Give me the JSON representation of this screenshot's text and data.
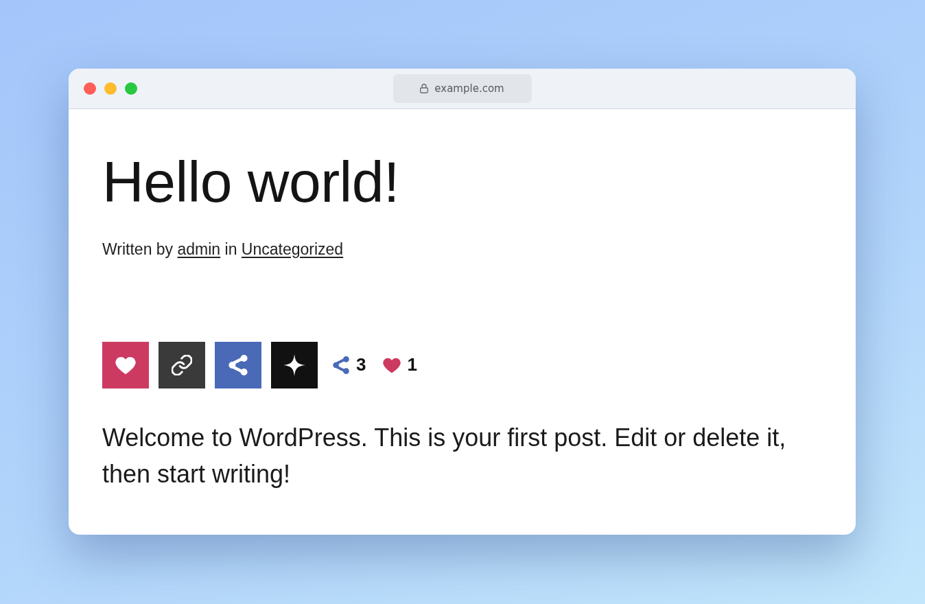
{
  "browser": {
    "window_controls": [
      {
        "color": "#ff5f57"
      },
      {
        "color": "#febc2e"
      },
      {
        "color": "#28c840"
      }
    ],
    "address": "example.com"
  },
  "post": {
    "title": "Hello world!",
    "byline": {
      "prefix": "Written by",
      "author": "admin",
      "joiner": "in",
      "category": "Uncategorized"
    },
    "share_buttons": [
      {
        "kind": "heart",
        "color": "#cc3a62"
      },
      {
        "kind": "link",
        "color": "#3a3a3a"
      },
      {
        "kind": "share",
        "color": "#4a6ab8"
      },
      {
        "kind": "sparkle",
        "color": "#111111"
      }
    ],
    "counters": [
      {
        "kind": "share",
        "count": "3"
      },
      {
        "kind": "heart",
        "count": "1"
      }
    ],
    "body": "Welcome to WordPress. This is your first post. Edit or delete it, then start writing!"
  }
}
